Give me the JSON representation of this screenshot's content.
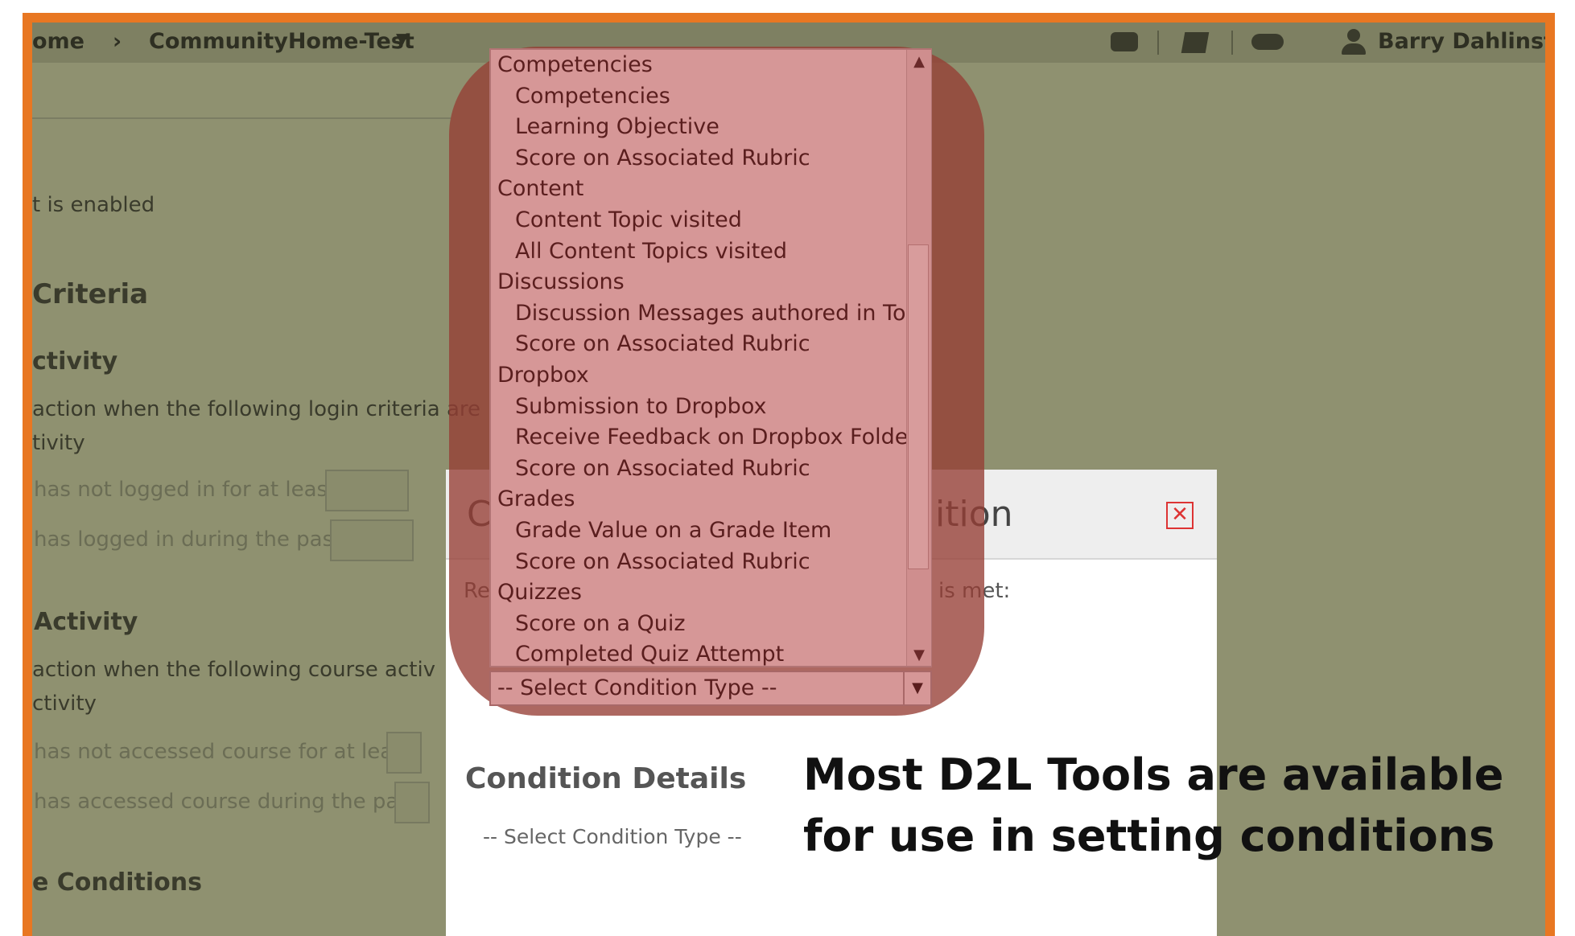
{
  "header": {
    "breadcrumb_home": "ome",
    "breadcrumb_separator": "›",
    "breadcrumb_course": "CommunityHome-Test",
    "course_menu_icon": "caret-down-icon",
    "icons": [
      "message-icon",
      "mail-icon",
      "notifications-icon"
    ],
    "user_name": "Barry Dahlinstr"
  },
  "background_page": {
    "enabled_text": "t is enabled",
    "criteria_heading": "Criteria",
    "login_activity_heading": "ctivity",
    "login_activity_desc_1": "action when the following login criteria are",
    "login_activity_desc_2": "tivity",
    "not_logged_in_label": "has not logged in for at least",
    "logged_in_label": "has logged in during the past",
    "course_activity_heading": "Activity",
    "course_activity_desc_1": "action when the following course activ",
    "course_activity_desc_2": "ctivity",
    "not_accessed_label": "has not accessed course for at least",
    "accessed_label": "has accessed course during the past",
    "conditions_heading": "e Conditions"
  },
  "dialog": {
    "title_left": "C",
    "title_right": "ition",
    "close_icon": "close-icon",
    "req_left": "Re",
    "req_right": "is met:",
    "condition_details_heading": "Condition Details",
    "condition_details_placeholder": "-- Select Condition Type --"
  },
  "dropdown": {
    "items": [
      {
        "type": "group",
        "label": "Competencies"
      },
      {
        "type": "option",
        "label": "Competencies"
      },
      {
        "type": "option",
        "label": "Learning Objective"
      },
      {
        "type": "option",
        "label": "Score on Associated Rubric"
      },
      {
        "type": "group",
        "label": "Content"
      },
      {
        "type": "option",
        "label": "Content Topic visited"
      },
      {
        "type": "option",
        "label": "All Content Topics visited"
      },
      {
        "type": "group",
        "label": "Discussions"
      },
      {
        "type": "option",
        "label": "Discussion Messages authored in Topic"
      },
      {
        "type": "option",
        "label": "Score on Associated Rubric"
      },
      {
        "type": "group",
        "label": "Dropbox"
      },
      {
        "type": "option",
        "label": "Submission to Dropbox"
      },
      {
        "type": "option",
        "label": "Receive Feedback on Dropbox Folder"
      },
      {
        "type": "option",
        "label": "Score on Associated Rubric"
      },
      {
        "type": "group",
        "label": "Grades"
      },
      {
        "type": "option",
        "label": "Grade Value on a Grade Item"
      },
      {
        "type": "option",
        "label": "Score on Associated Rubric"
      },
      {
        "type": "group",
        "label": "Quizzes"
      },
      {
        "type": "option",
        "label": "Score on a Quiz"
      },
      {
        "type": "option",
        "label": "Completed Quiz Attempt"
      }
    ],
    "selected_value": "-- Select Condition Type --"
  },
  "caption": {
    "line1": "Most D2L Tools are available",
    "line2": "for use in setting conditions"
  },
  "colors": {
    "frame": "#e87722",
    "overlay": "#8f9170",
    "highlight": "#963e34",
    "dropdown_bg": "#d69797"
  }
}
